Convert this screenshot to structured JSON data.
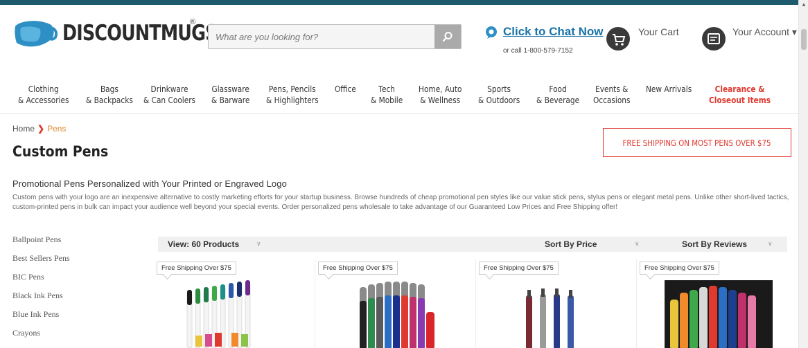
{
  "header": {
    "logo_text": "DISCOUNTMUGS",
    "logo_mark": "®",
    "search_placeholder": "What are you looking for?",
    "chat_link": "Click to Chat Now",
    "chat_phone": "or call 1-800-579-7152",
    "cart_label": "Your Cart",
    "account_label": "Your Account",
    "account_caret": "▾"
  },
  "nav": [
    {
      "line1": "Clothing",
      "line2": "& Accessories"
    },
    {
      "line1": "Bags",
      "line2": "& Backpacks"
    },
    {
      "line1": "Drinkware",
      "line2": "& Can Coolers"
    },
    {
      "line1": "Glassware",
      "line2": "& Barware"
    },
    {
      "line1": "Pens, Pencils",
      "line2": "& Highlighters"
    },
    {
      "line1": "Office",
      "line2": ""
    },
    {
      "line1": "Tech",
      "line2": "& Mobile"
    },
    {
      "line1": "Home, Auto",
      "line2": "& Wellness"
    },
    {
      "line1": "Sports",
      "line2": "& Outdoors"
    },
    {
      "line1": "Food",
      "line2": "& Beverage"
    },
    {
      "line1": "Events &",
      "line2": "Occasions"
    },
    {
      "line1": "New Arrivals",
      "line2": ""
    },
    {
      "line1": "Clearance &",
      "line2": "Closeout Items"
    }
  ],
  "breadcrumb": {
    "home": "Home",
    "separator": "❯",
    "current": "Pens"
  },
  "page_title": "Custom Pens",
  "shipping_banner": "FREE SHIPPING ON MOST PENS OVER $75",
  "subheading": "Promotional Pens Personalized with Your Printed or Engraved Logo",
  "description": "Custom pens with your logo are an inexpensive alternative to costly marketing efforts for your startup business. Browse hundreds of cheap promotional pen styles like our value stick pens, stylus pens or elegant metal pens. Unlike other short-lived tactics, custom-printed pens in bulk can impact your audience well beyond your special events. Order personalized pens wholesale to take advantage of our Guaranteed Low Prices and Free Shipping offer!",
  "sidebar": [
    "Ballpoint Pens",
    "Best Sellers Pens",
    "BIC Pens",
    "Black Ink Pens",
    "Blue Ink Pens",
    "Crayons"
  ],
  "toolbar": {
    "view": "View: 60 Products",
    "sort_price": "Sort By Price",
    "sort_reviews": "Sort By Reviews",
    "chevron": "∨"
  },
  "products": [
    {
      "badge": "Free Shipping Over $75"
    },
    {
      "badge": "Free Shipping Over $75"
    },
    {
      "badge": "Free Shipping Over $75"
    },
    {
      "badge": "Free Shipping Over $75"
    }
  ],
  "colors": {
    "accent_red": "#e03a2f",
    "link_blue": "#1a73a8",
    "top_bar": "#1d5a6e",
    "logo_blue": "#2e8fc4"
  }
}
